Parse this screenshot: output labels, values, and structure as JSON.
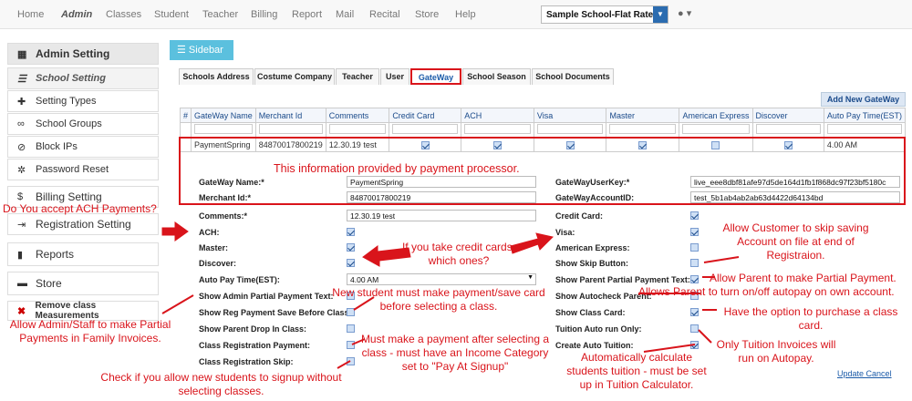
{
  "nav": {
    "items": [
      "Home",
      "Admin",
      "Classes",
      "Student",
      "Teacher",
      "Billing",
      "Report",
      "Mail",
      "Recital",
      "Store",
      "Help"
    ],
    "active": "Admin",
    "school_select": "Sample School-Flat Rate"
  },
  "sidebar": {
    "title": "Admin Setting",
    "items": [
      {
        "label": "School Setting",
        "icon": "list-icon"
      },
      {
        "label": "Setting Types",
        "icon": "plus-icon"
      },
      {
        "label": "School Groups",
        "icon": "link-icon"
      },
      {
        "label": "Block IPs",
        "icon": "ban-icon"
      },
      {
        "label": "Password Reset",
        "icon": "gear-icon"
      },
      {
        "label": "Billing Setting",
        "icon": "dollar-icon"
      },
      {
        "label": "Registration Setting",
        "icon": "sign-in-icon"
      },
      {
        "label": "Reports",
        "icon": "bar-chart-icon"
      },
      {
        "label": "Store",
        "icon": "cart-icon"
      },
      {
        "label": "Remove class Measurements",
        "icon": "close-icon"
      }
    ],
    "toggle_label": "Sidebar"
  },
  "tabs": [
    "Schools Address",
    "Costume Company",
    "Teacher",
    "User",
    "GateWay",
    "School Season",
    "School Documents"
  ],
  "active_tab": "GateWay",
  "add_button": "Add New GateWay",
  "grid": {
    "columns": [
      "#",
      "GateWay Name",
      "Merchant Id",
      "Comments",
      "Credit Card",
      "ACH",
      "Visa",
      "Master",
      "American Express",
      "Discover",
      "Auto Pay Time(EST)"
    ],
    "row": {
      "name": "PaymentSpring",
      "merchant": "84870017800219",
      "comments": "12.30.19 test",
      "credit_card": true,
      "ach": true,
      "visa": true,
      "master": true,
      "amex": false,
      "discover": true,
      "auto_pay": "4.00 AM"
    }
  },
  "form": {
    "gateway_name_label": "GateWay Name:*",
    "gateway_name": "PaymentSpring",
    "merchant_label": "Merchant Id:*",
    "merchant": "84870017800219",
    "comments_label": "Comments:*",
    "comments": "12.30.19 test",
    "userkey_label": "GateWayUserKey:*",
    "userkey": "live_eee8dbf81afe97d5de164d1fb1f868dc97f23bf5180c",
    "account_label": "GateWayAccountID:",
    "account": "test_5b1ab4ab2ab63d4422d64134bd",
    "left_fields": [
      {
        "label": "ACH:",
        "on": true
      },
      {
        "label": "Master:",
        "on": true
      },
      {
        "label": "Discover:",
        "on": true
      },
      {
        "label": "Auto Pay Time(EST):",
        "value": "4.00 AM"
      },
      {
        "label": "Show Admin Partial Payment Text:",
        "on": false
      },
      {
        "label": "Show Reg Payment Save Before Class:",
        "on": false
      },
      {
        "label": "Show Parent Drop In Class:",
        "on": false
      },
      {
        "label": "Class Registration Payment:",
        "on": false
      },
      {
        "label": "Class Registration Skip:",
        "on": false
      }
    ],
    "right_fields": [
      {
        "label": "Credit Card:",
        "on": true
      },
      {
        "label": "Visa:",
        "on": true
      },
      {
        "label": "American Express:",
        "on": false
      },
      {
        "label": "Show Skip Button:",
        "on": false
      },
      {
        "label": "Show Parent Partial Payment Text:",
        "on": true
      },
      {
        "label": "Show Autocheck Parent:",
        "on": false
      },
      {
        "label": "Show Class Card:",
        "on": true
      },
      {
        "label": "Tuition Auto run Only:",
        "on": false
      },
      {
        "label": "Create Auto Tuition:",
        "on": true
      }
    ],
    "update": "Update",
    "cancel": "Cancel"
  },
  "annotations": {
    "processor": "This information provided by payment processor.",
    "ach": "Do You accept ACH Payments?",
    "credit": "If you take credit cards, which ones?",
    "skip": "Allow Customer to skip saving Account on file at end of Registraion.",
    "partial": "Allow Parent to make Partial Payment.",
    "autopay": "Allows Parent to turn on/off autopay on own account.",
    "newstudent": "New student must make payment/save card before selecting a class.",
    "classcard": "Have the option to purchase a class card.",
    "admin": "Allow Admin/Staff to make Partial Payments in Family Invoices.",
    "mustpay": "Must make a payment after selecting a class - must have an Income Category set to \"Pay At Signup\"",
    "tuitiononly": "Only Tuition Invoices will run on Autopay.",
    "autocalc": "Automatically calculate students tuition - must be set up in Tuition Calculator.",
    "signup": "Check if you allow new students to signup without selecting classes."
  }
}
